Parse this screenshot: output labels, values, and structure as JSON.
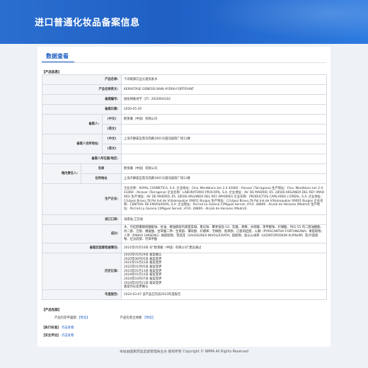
{
  "header": {
    "title": "进口普通化妆品备案信息"
  },
  "tab": {
    "label": "数据查看"
  },
  "product_section": {
    "title": "【产品信息】"
  },
  "labels": {
    "product_name": "产品名称:",
    "product_name_en": "产品名称英文:",
    "record_no": "备案编号:",
    "record_date": "备案日期:",
    "registrant": "备案人:",
    "registrant_addr": "备案人住所地址:",
    "registrant_country": "备案人所在国/地区:",
    "domestic_agent": "境内责任人:",
    "manufacturer": "生产企业:",
    "importer": "进口口岸:",
    "ingredients": "成分:",
    "status": "备案后监督检查情况:",
    "history": "历史记录:",
    "annual": "年度报告:",
    "zh": "(中文)",
    "en": "(英文)",
    "name": "名称",
    "address": "住所地址"
  },
  "values": {
    "product_name": "卡诗赋源芯丝沁透洗发水",
    "product_name_en": "KERASTASE GENESIS BAIN HYDRA-FORTIFIANT",
    "record_no": "国妆网备进字（沪）2020004102",
    "record_date": "2020-05-29",
    "registrant_zh": "欧莱雅（中国）有限公司",
    "registrant_en": "",
    "registrant_addr_zh": "上海市静安区南京西路1601号越洋国际广场11楼",
    "registrant_addr_en": "",
    "registrant_country": "",
    "agent_name": "欧莱雅（中国）有限公司",
    "agent_address": "上海市静安区南京西路1601号越洋国际广场11楼",
    "manufacturer": "企业名称：ROYAL COSMETICA, S.A. 企业地址：Ctra. Montblanc km 2.4 43460 - Alcover (Tarragona) 生产地址：Ctra. Montblanc km 2.4 43460 - Alcover (Tarragona) 企业名称：LABORATORIO PROCAPIL, S.A. 企业地址：AV. DE MADRID, 65. 28500-ARGANDA DEL REY (MADRID) 生产地址：AV. DE MADRID, 65. 28500-ARGANDA DEL REY (MADRID) 企业名称：PRODUCTOS CAPILARES L'ORÉAL, S.A. 企业地址：C/López Bravo,78 Pol.Ind.de Villalonquéjar 09001 Burgos 生产地址：C/López Bravo,78 Pol.Ind.de Villalonquéjar 09001 Burgos 企业名称：CENTRAL DE ENVASADOS, S.A. 企业地址：Pol.Ind.La Garena C/Miguel Servet, nº10. 28806 - Alcalá de Henares (Madrid) 生产地址：Pol.Ind.La Garena C/Miguel Servet, nº10. 28806 - Alcalá de Henares (Madrid)",
    "importer": "海南省,江苏省",
    "ingredients": "水、月桂醇聚醚硫酸酯钠、甘油、椰油酰胺丙基甜菜碱、氯化钠、聚季铵盐-10、乳酸、香精、水杨酸、苯甲酸钠、柠檬酸、PEG-55 丙二醇油酸酯、丙二醇、泛醇、精氨酸、甘草酸二钾、生育酚、薄荷醇、柠檬烯、芳樟醇、香茅醇、己基肉桂醛、火棘（PYRACANTHA FORTUNEANA）果提取物、人参（PANAX GINSENG）根提取物、雪莲花（SAUSSUREA INVOLUCRATA）提取物、高山火绒草（LEONTOPODIUM ALPINUM）花/叶提取物、红没药醇、羟苯甲酯",
    "status": "2021年05月10日 对“欧莱雅（中国）有限公司”建议通过",
    "history": [
      "2020年05月29日 备案确认",
      "2020年06月05日 备案变更",
      "2021年01月22日 备案变更",
      "2022年01月05日 备案变更",
      "2023年01月13日 备案变更",
      "2024年01月12日 备案变更",
      "2024年03月07日 备案变更",
      "2024年05月21日 备案变更",
      "备案凭证变更确认"
    ],
    "annual": "2024-03-07 该产品已完成2023年度报告"
  },
  "files_section": {
    "title": "【产品包装】",
    "plan_label": "产品包装平面图",
    "plan_link": "【预览】",
    "sub_label": "产品包装立体图",
    "sub_link": "【预览】"
  },
  "exec_section": {
    "title": "【执行标准】",
    "link": "点击查看"
  },
  "safety_section": {
    "title": "【安全评估】",
    "link": "点击查看"
  },
  "footer": {
    "text": "本站由国家药品监督管理局主办 版权所有 Copyright © NMPA All Rights Reserved"
  }
}
